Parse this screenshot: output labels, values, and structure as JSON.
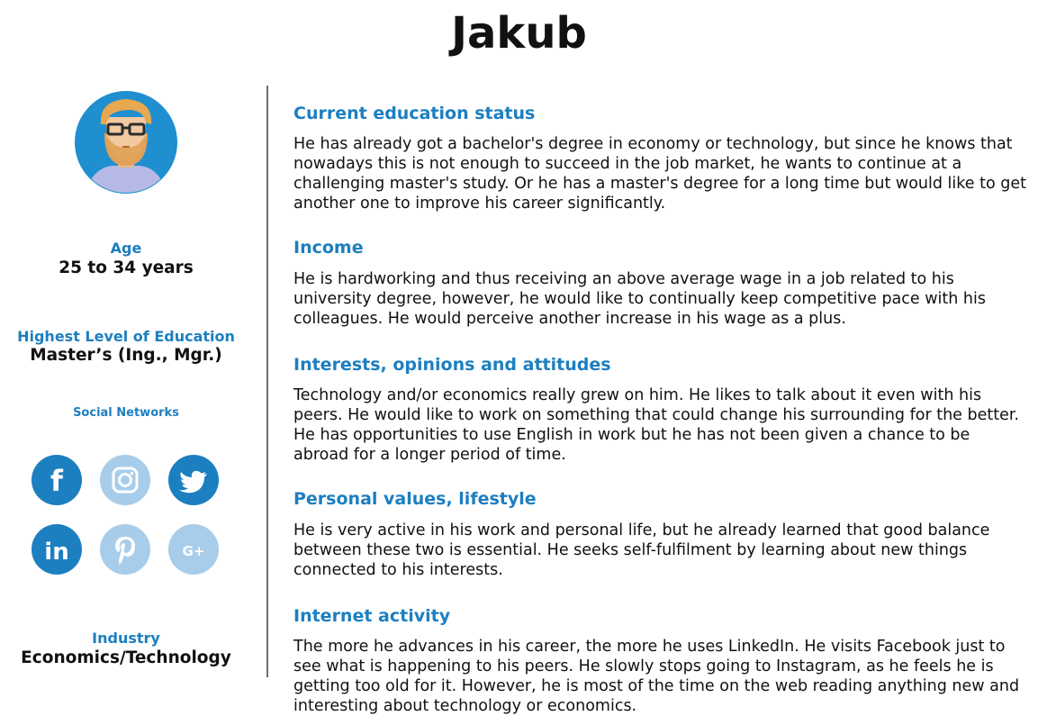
{
  "title": "Jakub",
  "sidebar": {
    "age": {
      "label": "Age",
      "value": "25 to 34 years"
    },
    "education": {
      "label": "Highest Level of Education",
      "value": "Master’s (Ing., Mgr.)"
    },
    "social": {
      "label": "Social Networks",
      "icons": [
        {
          "name": "facebook-icon",
          "glyph": "f",
          "color": "#1c7fc0"
        },
        {
          "name": "instagram-icon",
          "glyph": "",
          "color": "#a7cdea"
        },
        {
          "name": "twitter-icon",
          "glyph": "",
          "color": "#1c7fc0"
        },
        {
          "name": "linkedin-icon",
          "glyph": "in",
          "color": "#1c7fc0"
        },
        {
          "name": "pinterest-icon",
          "glyph": "P",
          "color": "#a7cdea"
        },
        {
          "name": "google-plus-icon",
          "glyph": "G+",
          "color": "#a7cdea"
        }
      ]
    },
    "industry": {
      "label": "Industry",
      "value": "Economics/Technology"
    }
  },
  "sections": [
    {
      "heading": "Current education status",
      "text": "He has already got a bachelor's degree in economy or technology, but since he knows that nowadays this is not enough to succeed in the job market, he wants to continue at a challenging master's study. Or he has a master's degree for a long time but would like to get another one to improve his career significantly."
    },
    {
      "heading": "Income",
      "text": "He is hardworking and thus receiving an above average wage in a job related to his university degree, however, he would like to continually keep competitive pace with his colleagues. He would perceive another increase in his wage as a plus."
    },
    {
      "heading": "Interests, opinions and attitudes",
      "text": "Technology and/or economics really grew on him. He likes to talk about it even with his peers. He would like to work on something that could change his surrounding for the better. He has opportunities to use English in work but he has not been given a chance to be abroad for a longer period of time."
    },
    {
      "heading": "Personal values, lifestyle",
      "text": "He is very active in his work and personal life, but he already learned that good balance between these two is essential. He seeks self-fulfilment by learning about new things connected to his interests."
    },
    {
      "heading": "Internet activity",
      "text": "The more he advances in his career, the more he uses LinkedIn. He visits Facebook just to see what is happening to his peers. He slowly stops going to Instagram, as he feels he is getting too old for it. However, he is most of the time on the web reading anything new and interesting about technology or economics."
    }
  ]
}
